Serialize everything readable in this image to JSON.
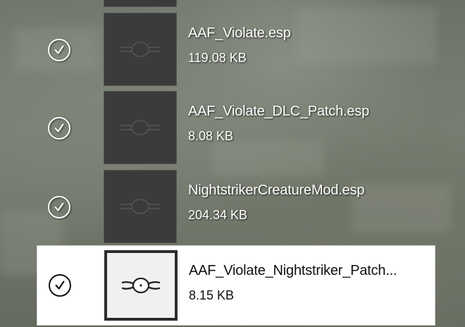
{
  "files": [
    {
      "name": "AAF_Violate.esp",
      "size": "119.08 KB",
      "checked": true,
      "selected": false
    },
    {
      "name": "AAF_Violate_DLC_Patch.esp",
      "size": "8.08 KB",
      "checked": true,
      "selected": false
    },
    {
      "name": "NightstrikerCreatureMod.esp",
      "size": "204.34 KB",
      "checked": true,
      "selected": false
    },
    {
      "name": "AAF_Violate_Nightstriker_Patch...",
      "size": "8.15 KB",
      "checked": true,
      "selected": true
    }
  ],
  "icons": {
    "checkbox": "checkmark-circle-icon",
    "thumbnail": "vault-gear-icon"
  }
}
